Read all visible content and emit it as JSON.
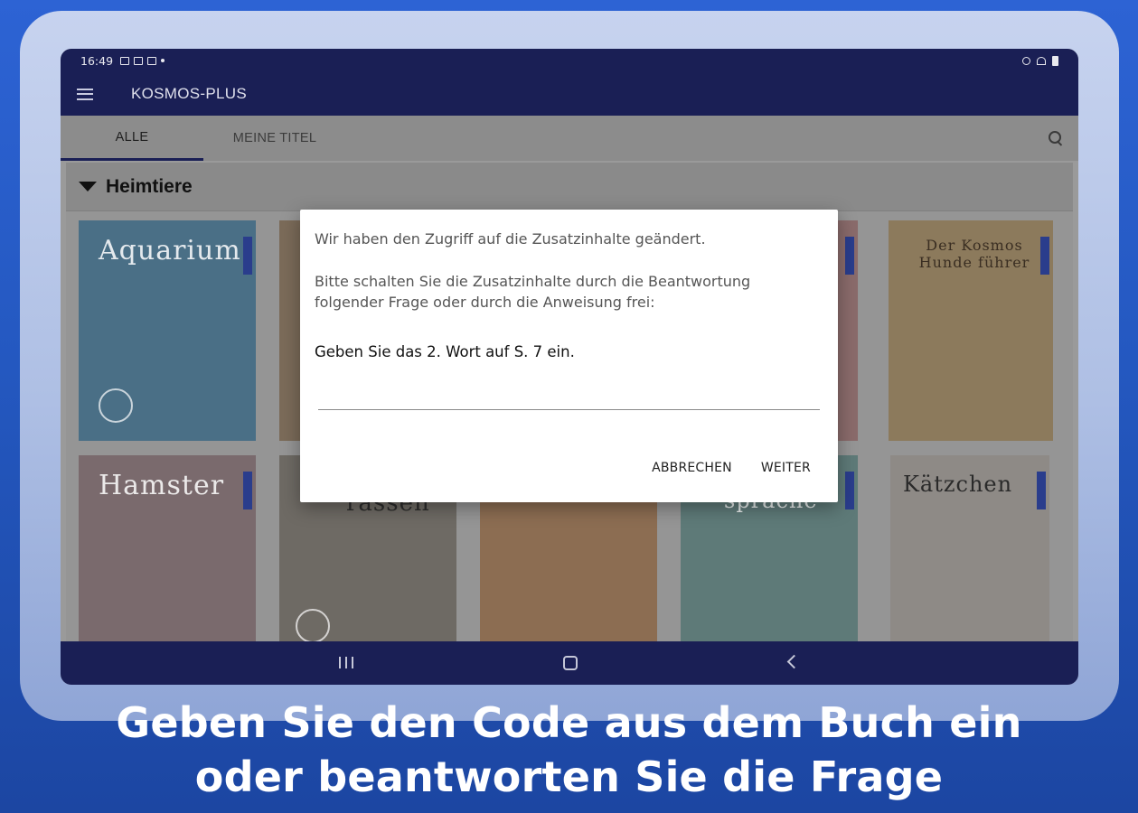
{
  "status_bar": {
    "time": "16:49"
  },
  "app_bar": {
    "title": "KOSMOS-PLUS"
  },
  "tabs": [
    {
      "label": "ALLE",
      "active": true
    },
    {
      "label": "MEINE TITEL",
      "active": false
    }
  ],
  "section": {
    "title": "Heimtiere"
  },
  "books": [
    {
      "title": "Aquarium",
      "color": "#4a6f86"
    },
    {
      "title": "",
      "color": "#7b6b59"
    },
    {
      "title": "",
      "color": "#6f7a70"
    },
    {
      "title": "",
      "color": "#8a6b6b"
    },
    {
      "title": "Der Kosmos Hunde führer",
      "color": "#8c7a5c"
    },
    {
      "title": "Hamster",
      "color": "#7a6a6d"
    },
    {
      "title": "rassen",
      "color": "#6e6a64"
    },
    {
      "title": "",
      "color": "#8c6d52"
    },
    {
      "title": "sprache",
      "color": "#5e7a78"
    },
    {
      "title": "Kätzchen",
      "color": "#8e8a86"
    }
  ],
  "dialog": {
    "line1": "Wir haben den Zugriff auf die Zusatzinhalte geändert.",
    "paragraph": "Bitte schalten Sie die Zusatzinhalte durch die Beantwortung folgender Frage oder durch die Anweisung frei:",
    "question": "Geben Sie das 2. Wort auf S. 7 ein.",
    "input_value": "",
    "cancel_label": "ABBRECHEN",
    "next_label": "WEITER"
  },
  "caption": {
    "line1": "Geben Sie den Code aus dem Buch ein",
    "line2": "oder beantworten Sie die Frage"
  },
  "colors": {
    "brand": "#1a1f55",
    "background": "#2458c0"
  }
}
